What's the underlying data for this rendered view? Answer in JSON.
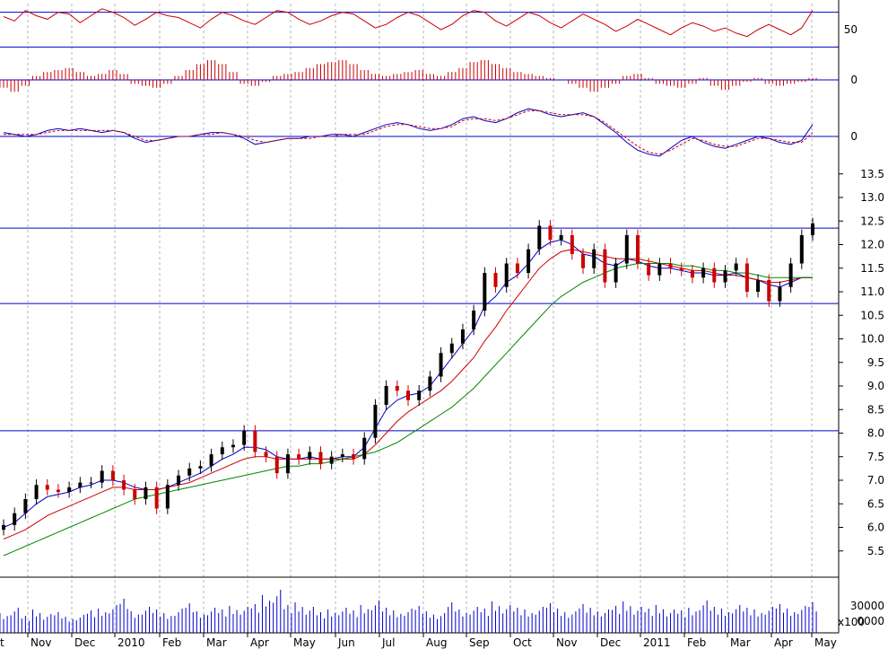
{
  "colors": {
    "background": "#ffffff",
    "guide_line": "#0000cc",
    "up_candle": "#000000",
    "down_candle": "#cc0000",
    "ma_fast": "#0000cc",
    "ma_mid": "#cc0000",
    "ma_slow": "#008800",
    "volume": "#0000cc",
    "rsi": "#cc0000",
    "histogram": "#cc0000"
  },
  "chart_data": [
    {
      "type": "line",
      "panel": "rsi",
      "right_tick_labels": [
        "50"
      ],
      "guide_levels": [
        70,
        30
      ],
      "ylim": [
        20,
        80
      ],
      "series": [
        {
          "values": [
            65,
            60,
            72,
            66,
            62,
            70,
            68,
            58,
            66,
            74,
            70,
            64,
            55,
            62,
            70,
            66,
            64,
            58,
            52,
            62,
            70,
            66,
            60,
            56,
            64,
            72,
            70,
            62,
            56,
            60,
            66,
            70,
            68,
            60,
            52,
            56,
            64,
            70,
            66,
            58,
            50,
            56,
            66,
            72,
            70,
            60,
            54,
            62,
            70,
            66,
            58,
            52,
            60,
            68,
            62,
            56,
            48,
            54,
            62,
            56,
            50,
            44,
            52,
            58,
            54,
            48,
            52,
            46,
            42,
            50,
            56,
            50,
            44,
            52,
            72
          ]
        }
      ]
    },
    {
      "type": "bar",
      "panel": "histogram",
      "right_tick_labels": [
        "0"
      ],
      "series": [
        {
          "values": [
            -4,
            -6,
            -3,
            2,
            4,
            5,
            6,
            4,
            2,
            3,
            5,
            3,
            -2,
            -3,
            -4,
            -2,
            2,
            5,
            8,
            10,
            8,
            4,
            -2,
            -3,
            -1,
            2,
            3,
            4,
            6,
            8,
            9,
            10,
            8,
            5,
            3,
            2,
            3,
            4,
            5,
            3,
            2,
            4,
            6,
            9,
            10,
            8,
            6,
            4,
            3,
            2,
            1,
            0,
            -2,
            -4,
            -6,
            -4,
            -2,
            2,
            3,
            1,
            -2,
            -3,
            -4,
            -2,
            1,
            -3,
            -5,
            -3,
            -1,
            1,
            -2,
            -3,
            -2,
            -1,
            1
          ]
        }
      ]
    },
    {
      "type": "line",
      "panel": "macd",
      "right_tick_labels": [
        "0"
      ],
      "series": [
        {
          "values": [
            2,
            1,
            0,
            1,
            3,
            4,
            3,
            4,
            3,
            2,
            3,
            2,
            -1,
            -3,
            -2,
            -1,
            0,
            0,
            1,
            2,
            2,
            1,
            -1,
            -4,
            -3,
            -2,
            -1,
            -1,
            0,
            0,
            1,
            1,
            0,
            2,
            4,
            6,
            7,
            6,
            4,
            3,
            4,
            6,
            9,
            10,
            8,
            7,
            9,
            12,
            14,
            13,
            11,
            10,
            11,
            12,
            10,
            6,
            2,
            -3,
            -7,
            -9,
            -10,
            -6,
            -2,
            0,
            -3,
            -5,
            -6,
            -4,
            -2,
            0,
            -1,
            -3,
            -4,
            -2,
            6
          ]
        },
        {
          "values": [
            1,
            1,
            1,
            1,
            2,
            3,
            3,
            3,
            3,
            3,
            3,
            2,
            0,
            -2,
            -2,
            -1,
            0,
            0,
            1,
            1,
            2,
            1,
            0,
            -2,
            -3,
            -2,
            -1,
            -1,
            -1,
            0,
            0,
            1,
            1,
            1,
            3,
            5,
            6,
            6,
            5,
            4,
            4,
            5,
            8,
            9,
            9,
            8,
            9,
            11,
            13,
            13,
            12,
            11,
            11,
            11,
            10,
            7,
            3,
            -1,
            -5,
            -8,
            -9,
            -7,
            -4,
            -1,
            -2,
            -4,
            -5,
            -5,
            -3,
            -1,
            -1,
            -2,
            -3,
            -3,
            2
          ]
        }
      ]
    },
    {
      "type": "candlestick",
      "panel": "price",
      "y_ticks": [
        "5.5",
        "6.0",
        "6.5",
        "7.0",
        "7.5",
        "8.0",
        "8.5",
        "9.0",
        "9.5",
        "10.0",
        "10.5",
        "11.0",
        "11.5",
        "12.0",
        "12.5",
        "13.0",
        "13.5"
      ],
      "guide_levels": [
        12.35,
        10.75,
        8.05
      ],
      "ylim": [
        5.0,
        13.8
      ],
      "close": [
        6.05,
        6.3,
        6.6,
        6.9,
        6.8,
        6.75,
        6.85,
        6.95,
        6.95,
        7.2,
        7.0,
        6.8,
        6.6,
        6.85,
        6.4,
        6.9,
        7.1,
        7.25,
        7.3,
        7.55,
        7.7,
        7.75,
        8.05,
        7.6,
        7.5,
        7.15,
        7.55,
        7.45,
        7.6,
        7.35,
        7.5,
        7.55,
        7.45,
        7.9,
        8.6,
        9.0,
        8.9,
        8.7,
        8.9,
        9.2,
        9.7,
        9.9,
        10.2,
        10.6,
        11.4,
        11.1,
        11.6,
        11.4,
        11.9,
        12.4,
        12.1,
        12.2,
        11.8,
        11.5,
        11.9,
        11.2,
        11.6,
        12.2,
        11.6,
        11.35,
        11.6,
        11.5,
        11.45,
        11.3,
        11.5,
        11.2,
        11.45,
        11.6,
        11.0,
        11.25,
        10.8,
        11.1,
        11.6,
        12.2,
        12.45
      ],
      "volume": [
        2200,
        2800,
        1900,
        2600,
        2100,
        2300,
        1800,
        2000,
        2500,
        2700,
        3100,
        3800,
        2400,
        2900,
        2600,
        2200,
        2700,
        3300,
        2400,
        2800,
        2600,
        3000,
        2900,
        3200,
        4200,
        4800,
        3100,
        3400,
        2900,
        2300,
        2600,
        2800,
        2500,
        3100,
        3600,
        2800,
        2500,
        2700,
        3000,
        2400,
        2200,
        3400,
        2600,
        2900,
        2700,
        3500,
        3100,
        2800,
        2600,
        2900,
        3300,
        2700,
        2400,
        3200,
        2800,
        2600,
        3000,
        3500,
        2900,
        2700,
        3100,
        2600,
        2500,
        2800,
        3600,
        2900,
        2700,
        3100,
        2800,
        2600,
        2900,
        3200,
        2700,
        3000,
        3400
      ],
      "series": [
        {
          "name": "",
          "style": "ma_fast",
          "values": [
            6.0,
            6.1,
            6.3,
            6.5,
            6.65,
            6.7,
            6.75,
            6.85,
            6.9,
            7.0,
            7.0,
            6.95,
            6.85,
            6.8,
            6.8,
            6.85,
            6.95,
            7.05,
            7.15,
            7.3,
            7.45,
            7.55,
            7.7,
            7.7,
            7.65,
            7.5,
            7.45,
            7.45,
            7.5,
            7.45,
            7.45,
            7.5,
            7.5,
            7.7,
            8.1,
            8.5,
            8.7,
            8.8,
            8.85,
            9.0,
            9.3,
            9.6,
            9.9,
            10.2,
            10.7,
            10.9,
            11.2,
            11.35,
            11.6,
            11.9,
            12.05,
            12.1,
            12.0,
            11.8,
            11.75,
            11.6,
            11.55,
            11.7,
            11.65,
            11.55,
            11.5,
            11.5,
            11.45,
            11.4,
            11.4,
            11.35,
            11.35,
            11.4,
            11.3,
            11.25,
            11.15,
            11.1,
            11.2,
            11.3,
            11.3
          ]
        },
        {
          "name": "",
          "style": "ma_mid",
          "values": [
            5.75,
            5.85,
            5.95,
            6.1,
            6.25,
            6.35,
            6.45,
            6.55,
            6.65,
            6.75,
            6.85,
            6.85,
            6.8,
            6.8,
            6.8,
            6.85,
            6.9,
            6.95,
            7.05,
            7.15,
            7.25,
            7.35,
            7.45,
            7.5,
            7.5,
            7.45,
            7.45,
            7.45,
            7.45,
            7.45,
            7.45,
            7.45,
            7.45,
            7.55,
            7.75,
            8.0,
            8.25,
            8.45,
            8.6,
            8.75,
            8.9,
            9.1,
            9.35,
            9.6,
            9.95,
            10.25,
            10.6,
            10.9,
            11.2,
            11.5,
            11.7,
            11.85,
            11.9,
            11.85,
            11.8,
            11.75,
            11.7,
            11.7,
            11.7,
            11.65,
            11.6,
            11.55,
            11.5,
            11.45,
            11.45,
            11.4,
            11.35,
            11.35,
            11.3,
            11.25,
            11.2,
            11.2,
            11.25,
            11.3,
            11.3
          ]
        },
        {
          "name": "",
          "style": "ma_slow",
          "values": [
            5.4,
            5.5,
            5.6,
            5.7,
            5.8,
            5.9,
            6.0,
            6.1,
            6.2,
            6.3,
            6.4,
            6.5,
            6.6,
            6.65,
            6.7,
            6.75,
            6.8,
            6.85,
            6.9,
            6.95,
            7.0,
            7.05,
            7.1,
            7.15,
            7.2,
            7.25,
            7.3,
            7.3,
            7.35,
            7.35,
            7.4,
            7.45,
            7.5,
            7.55,
            7.6,
            7.7,
            7.8,
            7.95,
            8.1,
            8.25,
            8.4,
            8.55,
            8.75,
            8.95,
            9.2,
            9.45,
            9.7,
            9.95,
            10.2,
            10.45,
            10.7,
            10.9,
            11.05,
            11.2,
            11.3,
            11.4,
            11.5,
            11.55,
            11.6,
            11.6,
            11.6,
            11.6,
            11.55,
            11.55,
            11.5,
            11.45,
            11.45,
            11.4,
            11.4,
            11.35,
            11.3,
            11.3,
            11.3,
            11.3,
            11.3
          ]
        }
      ]
    }
  ],
  "volume_panel": {
    "tick_label": "30000",
    "tick_value": 30000,
    "second_label": "0000",
    "multiplier_label": "x100",
    "ylim": [
      0,
      60000
    ]
  },
  "x_axis": {
    "partial_label": "t",
    "months": [
      "Nov",
      "Dec",
      "2010",
      "Feb",
      "Mar",
      "Apr",
      "May",
      "Jun",
      "Jul",
      "Aug",
      "Sep",
      "Oct",
      "Nov",
      "Dec",
      "2011",
      "Feb",
      "Mar",
      "Apr",
      "May"
    ]
  }
}
